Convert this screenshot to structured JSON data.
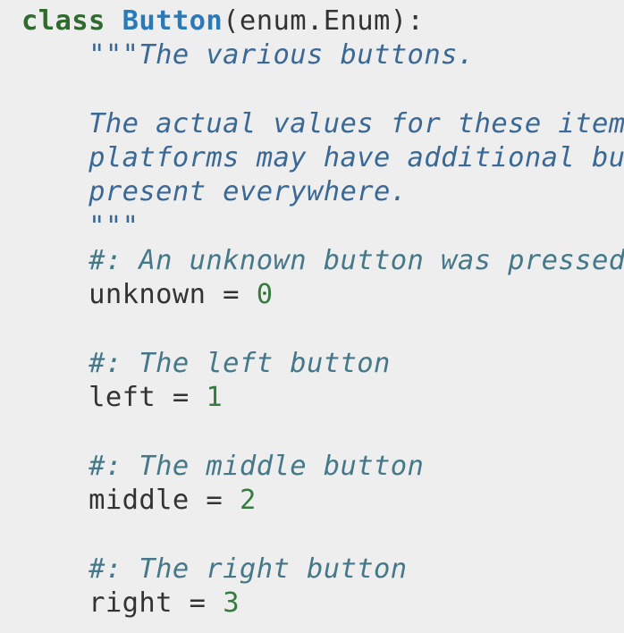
{
  "colors": {
    "background": "#eeeeee",
    "keyword": "#2f6b2f",
    "class_name": "#2b7ab8",
    "docstring": "#3a6996",
    "comment": "#457888",
    "number": "#367c42",
    "text": "#333333"
  },
  "code": {
    "class_keyword": "class",
    "class_name": "Button",
    "class_bases": "(enum.Enum):",
    "docstring_lines": [
      "\"\"\"The various buttons.",
      "The actual values for these items differ between platforms and some",
      "platforms may have additional buttons available. These buttons are not",
      "present everywhere.",
      "\"\"\""
    ],
    "members": [
      {
        "comment": "#: An unknown button was pressed",
        "name": "unknown",
        "op": " = ",
        "value": "0"
      },
      {
        "comment": "#: The left button",
        "name": "left",
        "op": " = ",
        "value": "1"
      },
      {
        "comment": "#: The middle button",
        "name": "middle",
        "op": " = ",
        "value": "2"
      },
      {
        "comment": "#: The right button",
        "name": "right",
        "op": " = ",
        "value": "3"
      }
    ]
  }
}
